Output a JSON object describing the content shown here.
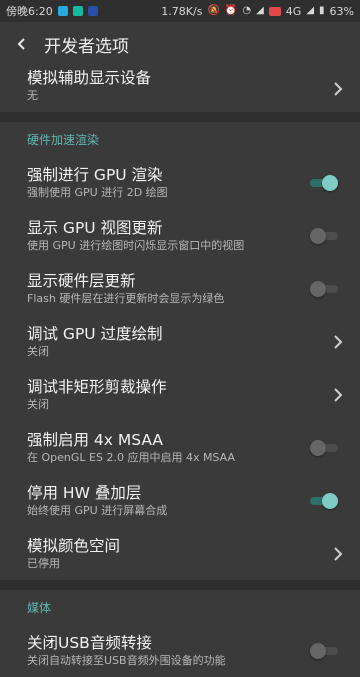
{
  "status": {
    "time": "傍晚6:20",
    "speed": "1.78K/s",
    "network": "4G",
    "battery": "63%"
  },
  "toolbar": {
    "title": "开发者选项"
  },
  "partial": {
    "title": "模拟辅助显示设备",
    "summary": "无"
  },
  "section_hw": "硬件加速渲染",
  "items": [
    {
      "title": "强制进行 GPU 渲染",
      "summary": "强制使用 GPU 进行 2D 绘图",
      "control": "switch",
      "checked": true
    },
    {
      "title": "显示 GPU 视图更新",
      "summary": "使用 GPU 进行绘图时闪烁显示窗口中的视图",
      "control": "switch",
      "checked": false
    },
    {
      "title": "显示硬件层更新",
      "summary": "Flash 硬件层在进行更新时会显示为绿色",
      "control": "switch",
      "checked": false
    },
    {
      "title": "调试 GPU 过度绘制",
      "summary": "关闭",
      "control": "chevron"
    },
    {
      "title": "调试非矩形剪裁操作",
      "summary": "关闭",
      "control": "chevron"
    },
    {
      "title": "强制启用 4x MSAA",
      "summary": "在 OpenGL ES 2.0 应用中启用 4x MSAA",
      "control": "switch",
      "checked": false
    },
    {
      "title": "停用 HW 叠加层",
      "summary": "始终使用 GPU 进行屏幕合成",
      "control": "switch",
      "checked": true
    },
    {
      "title": "模拟颜色空间",
      "summary": "已停用",
      "control": "chevron"
    }
  ],
  "section_media": "媒体",
  "media_item": {
    "title": "关闭USB音频转接",
    "summary": "关闭自动转接至USB音频外围设备的功能",
    "checked": false
  },
  "colors": {
    "accent": "#80cbc4",
    "section": "#5fb8b0",
    "background": "#3a3a3a"
  }
}
